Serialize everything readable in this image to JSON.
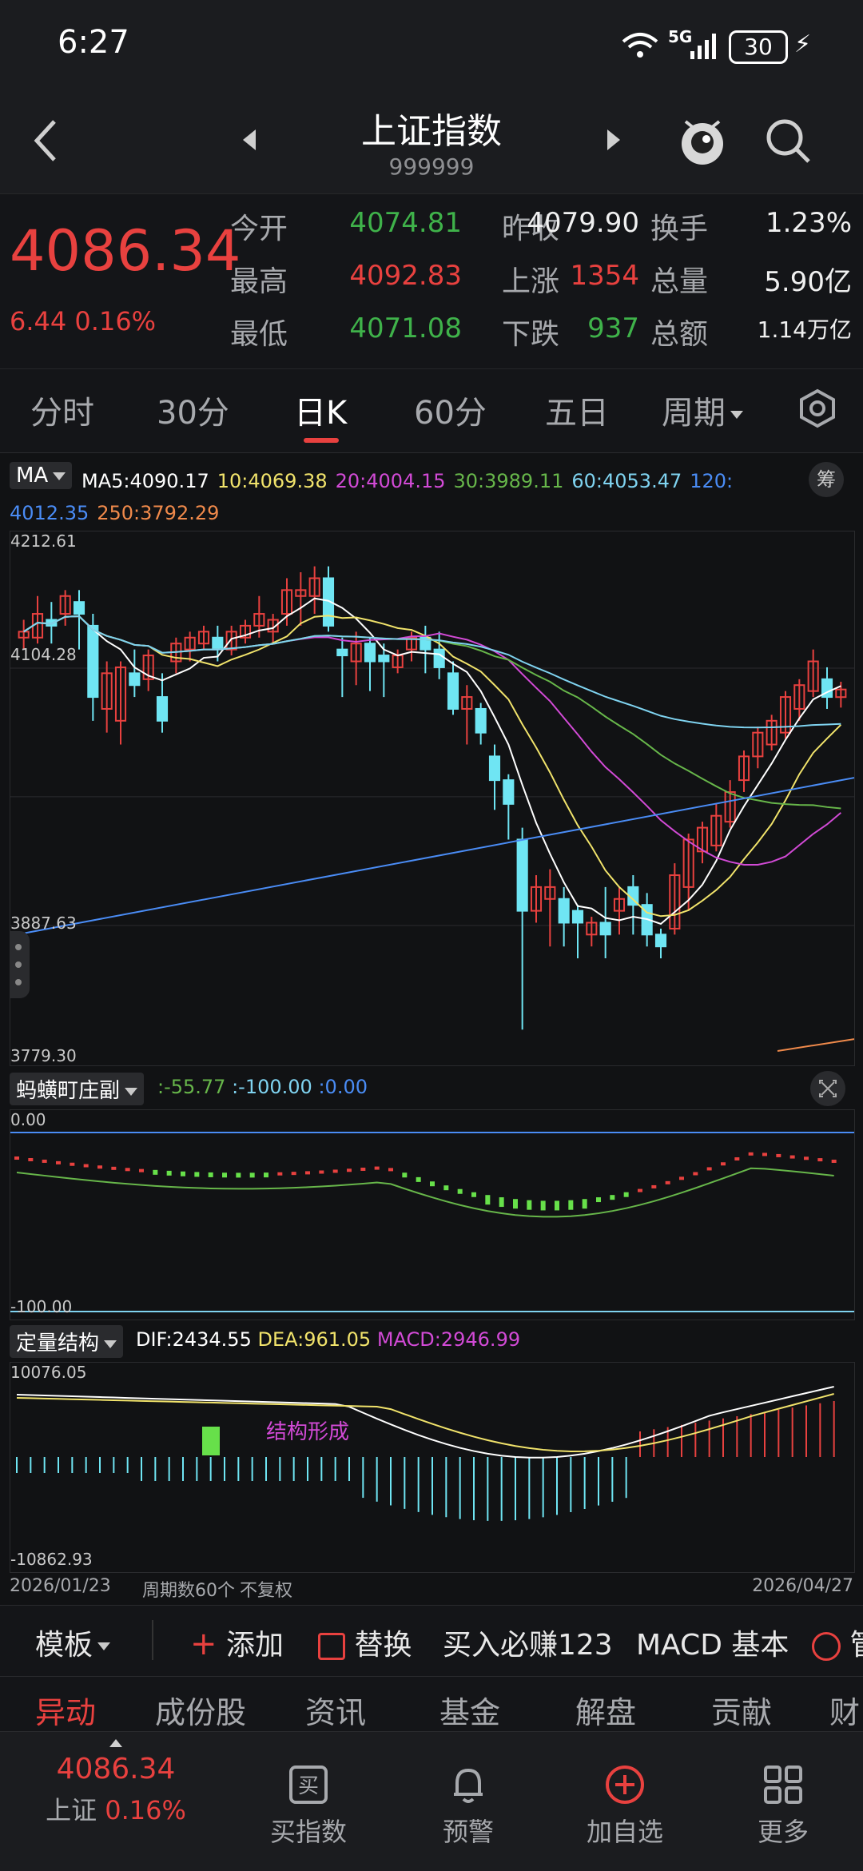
{
  "status_bar": {
    "time": "6:27",
    "battery": "30",
    "network": "5G"
  },
  "header": {
    "title": "上证指数",
    "code": "999999"
  },
  "quote": {
    "price": "4086.34",
    "change": "6.44",
    "change_pct": "0.16%",
    "rows": [
      [
        {
          "label": "今开",
          "value": "4074.81",
          "color": "green"
        },
        {
          "label": "昨收",
          "value": "4079.90",
          "color": "white"
        },
        {
          "label": "换手",
          "value": "1.23%",
          "color": "white"
        }
      ],
      [
        {
          "label": "最高",
          "value": "4092.83",
          "color": "red"
        },
        {
          "label": "上涨",
          "value": "1354",
          "color": "red"
        },
        {
          "label": "总量",
          "value": "5.90亿",
          "color": "white"
        }
      ],
      [
        {
          "label": "最低",
          "value": "4071.08",
          "color": "green"
        },
        {
          "label": "下跌",
          "value": "937",
          "color": "green"
        },
        {
          "label": "总额",
          "value": "1.14万亿",
          "color": "white"
        }
      ]
    ]
  },
  "periods": {
    "tabs": [
      "分时",
      "30分",
      "日K",
      "60分",
      "五日",
      "周期"
    ],
    "active": "日K"
  },
  "ma": {
    "selector": "MA",
    "badge": "筹",
    "items": [
      {
        "text": "MA5:4090.17",
        "color": "#ffffff"
      },
      {
        "text": "10:4069.38",
        "color": "#f1e36b"
      },
      {
        "text": "20:4004.15",
        "color": "#d24ad6"
      },
      {
        "text": "30:3989.11",
        "color": "#67b64a"
      },
      {
        "text": "60:4053.47",
        "color": "#7fd3f0"
      },
      {
        "text": "120:",
        "color": "#4a8cf5"
      },
      {
        "text": "4012.35",
        "color": "#4a8cf5"
      },
      {
        "text": "250:3792.29",
        "color": "#f08a4b"
      }
    ],
    "axis": {
      "top": "4212.61",
      "mid": "4104.28",
      "low": "3887.63",
      "bottom": "3779.30"
    }
  },
  "indicator1": {
    "selector": "蚂蟥町庄副",
    "values": [
      {
        "text": ":-55.77",
        "color": "#67b64a"
      },
      {
        "text": ":-100.00",
        "color": "#7fd3f0"
      },
      {
        "text": ":0.00",
        "color": "#4a8cf5"
      }
    ],
    "axis": {
      "top": "0.00",
      "bottom": "-100.00"
    }
  },
  "indicator2": {
    "selector": "定量结构",
    "values": [
      {
        "text": "DIF:2434.55",
        "color": "#ffffff"
      },
      {
        "text": "DEA:961.05",
        "color": "#f1e36b"
      },
      {
        "text": "MACD:2946.99",
        "color": "#d24ad6"
      }
    ],
    "annotation": "结构形成",
    "axis": {
      "top": "10076.05",
      "bottom": "-10862.93"
    }
  },
  "date_axis": {
    "start": "2026/01/23",
    "count": "周期数60个",
    "mode": "不复权",
    "end": "2026/04/27"
  },
  "toolbar": {
    "template": "模板",
    "add": "添加",
    "replace": "替换",
    "promo": "买入必赚123",
    "macd": "MACD 基本",
    "manage": "管"
  },
  "bottom_tabs": [
    "异动",
    "成份股",
    "资讯",
    "基金",
    "解盘",
    "贡献",
    "财"
  ],
  "bottom_nav": {
    "index_price": "4086.34",
    "index_name": "上证",
    "index_pct": "0.16%",
    "items": [
      "买指数",
      "预警",
      "加自选",
      "更多"
    ]
  },
  "chart_data": {
    "type": "candlestick",
    "ylim": [
      3779.3,
      4212.61
    ],
    "candles": [
      [
        4130,
        4135,
        4120,
        4145
      ],
      [
        4130,
        4150,
        4125,
        4165
      ],
      [
        4145,
        4140,
        4125,
        4160
      ],
      [
        4150,
        4165,
        4140,
        4170
      ],
      [
        4160,
        4150,
        4120,
        4170
      ],
      [
        4140,
        4080,
        4060,
        4150
      ],
      [
        4070,
        4100,
        4050,
        4110
      ],
      [
        4060,
        4105,
        4040,
        4110
      ],
      [
        4100,
        4090,
        4080,
        4120
      ],
      [
        4095,
        4115,
        4085,
        4120
      ],
      [
        4080,
        4060,
        4050,
        4100
      ],
      [
        4110,
        4125,
        4100,
        4130
      ],
      [
        4120,
        4130,
        4110,
        4135
      ],
      [
        4125,
        4135,
        4120,
        4140
      ],
      [
        4130,
        4120,
        4110,
        4140
      ],
      [
        4120,
        4135,
        4115,
        4140
      ],
      [
        4130,
        4140,
        4125,
        4145
      ],
      [
        4140,
        4150,
        4130,
        4165
      ],
      [
        4135,
        4145,
        4125,
        4150
      ],
      [
        4150,
        4170,
        4140,
        4180
      ],
      [
        4165,
        4170,
        4140,
        4185
      ],
      [
        4165,
        4180,
        4150,
        4190
      ],
      [
        4180,
        4140,
        4135,
        4190
      ],
      [
        4120,
        4115,
        4080,
        4130
      ],
      [
        4110,
        4125,
        4090,
        4135
      ],
      [
        4125,
        4110,
        4085,
        4130
      ],
      [
        4115,
        4110,
        4080,
        4125
      ],
      [
        4105,
        4115,
        4100,
        4120
      ],
      [
        4120,
        4130,
        4110,
        4135
      ],
      [
        4130,
        4120,
        4100,
        4140
      ],
      [
        4120,
        4105,
        4095,
        4135
      ],
      [
        4100,
        4070,
        4065,
        4110
      ],
      [
        4070,
        4080,
        4040,
        4090
      ],
      [
        4070,
        4050,
        4040,
        4075
      ],
      [
        4030,
        4010,
        3985,
        4040
      ],
      [
        4010,
        3990,
        3960,
        4015
      ],
      [
        3960,
        3900,
        3800,
        3970
      ],
      [
        3900,
        3920,
        3890,
        3930
      ],
      [
        3910,
        3920,
        3870,
        3935
      ],
      [
        3910,
        3890,
        3870,
        3920
      ],
      [
        3900,
        3890,
        3860,
        3905
      ],
      [
        3880,
        3890,
        3870,
        3895
      ],
      [
        3890,
        3880,
        3860,
        3920
      ],
      [
        3900,
        3910,
        3880,
        3920
      ],
      [
        3920,
        3905,
        3880,
        3930
      ],
      [
        3905,
        3880,
        3870,
        3915
      ],
      [
        3880,
        3870,
        3860,
        3885
      ],
      [
        3885,
        3930,
        3880,
        3940
      ],
      [
        3920,
        3960,
        3900,
        3965
      ],
      [
        3950,
        3970,
        3940,
        3975
      ],
      [
        3955,
        3980,
        3950,
        3990
      ],
      [
        3975,
        4000,
        3970,
        4010
      ],
      [
        4010,
        4030,
        4000,
        4035
      ],
      [
        4030,
        4050,
        4020,
        4055
      ],
      [
        4040,
        4060,
        4035,
        4065
      ],
      [
        4050,
        4080,
        4045,
        4085
      ],
      [
        4070,
        4090,
        4060,
        4095
      ],
      [
        4085,
        4110,
        4080,
        4120
      ],
      [
        4095,
        4080,
        4070,
        4105
      ],
      [
        4079.9,
        4086.34,
        4071.08,
        4092.83
      ]
    ]
  }
}
